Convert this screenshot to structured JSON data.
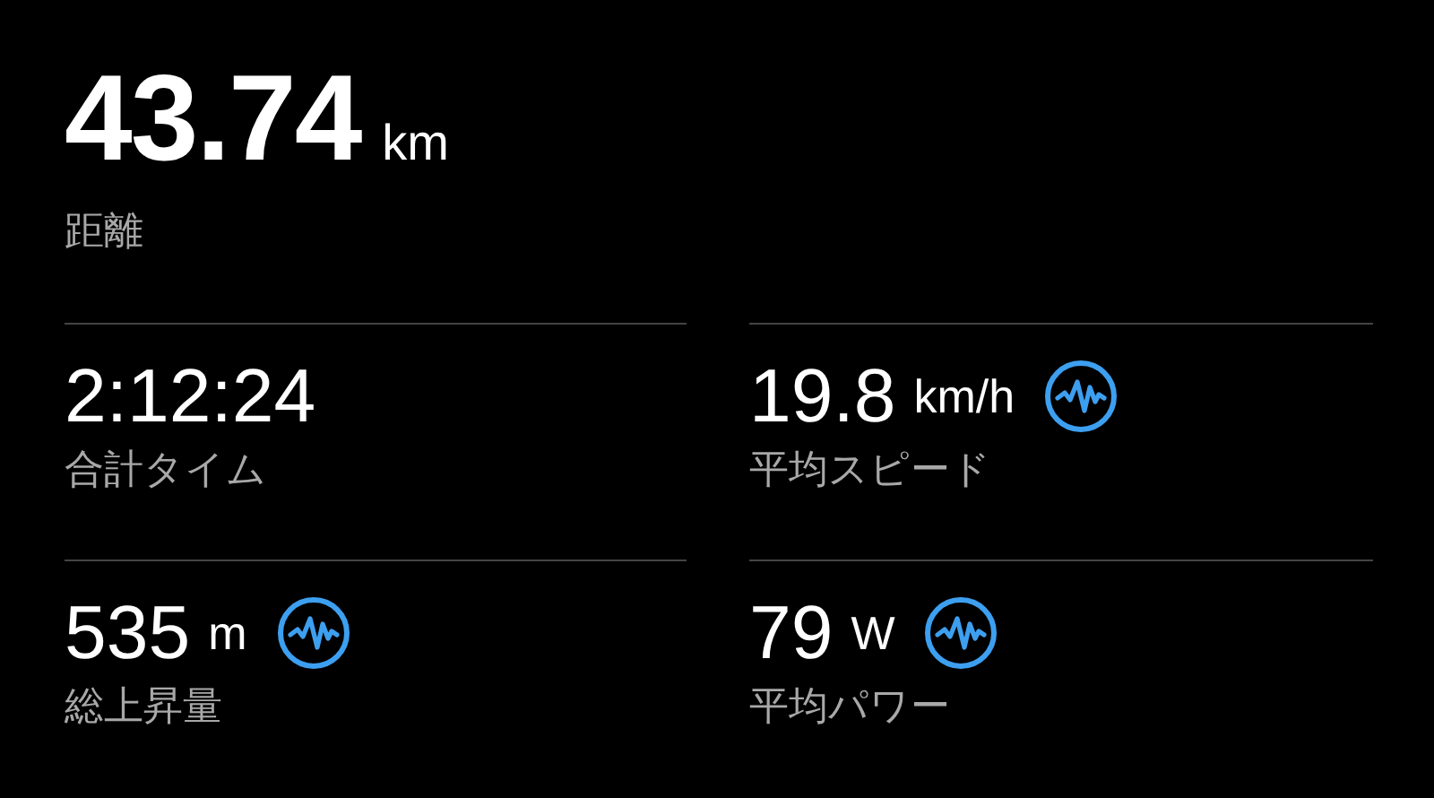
{
  "headline": {
    "value": "43.74",
    "unit": "km",
    "label": "距離"
  },
  "metrics": [
    {
      "value": "2:12:24",
      "label": "合計タイム",
      "chart": false
    },
    {
      "value": "19.8",
      "unit": "km/h",
      "label": "平均スピード",
      "chart": true
    },
    {
      "value": "535",
      "unit": "m",
      "label": "総上昇量",
      "chart": true
    },
    {
      "value": "79",
      "unit": "W",
      "label": "平均パワー",
      "chart": true
    }
  ]
}
